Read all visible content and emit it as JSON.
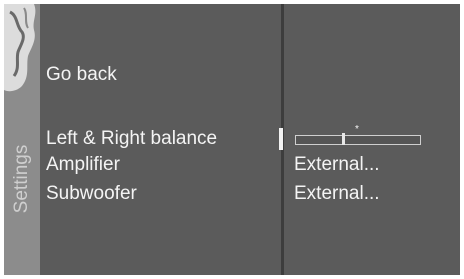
{
  "sidebar": {
    "label": "Settings",
    "logo_icon": "horse-head-logo-icon"
  },
  "menu": {
    "go_back": "Go back",
    "balance_label": "Left & Right balance",
    "amplifier_label": "Amplifier",
    "subwoofer_label": "Subwoofer"
  },
  "values": {
    "balance_position": 0.38,
    "balance_center": 0.5,
    "amplifier": "External...",
    "subwoofer": "External..."
  },
  "colors": {
    "background": "#5b5b5b",
    "rail": "#8c8c8c",
    "text": "#f4f4f4"
  }
}
